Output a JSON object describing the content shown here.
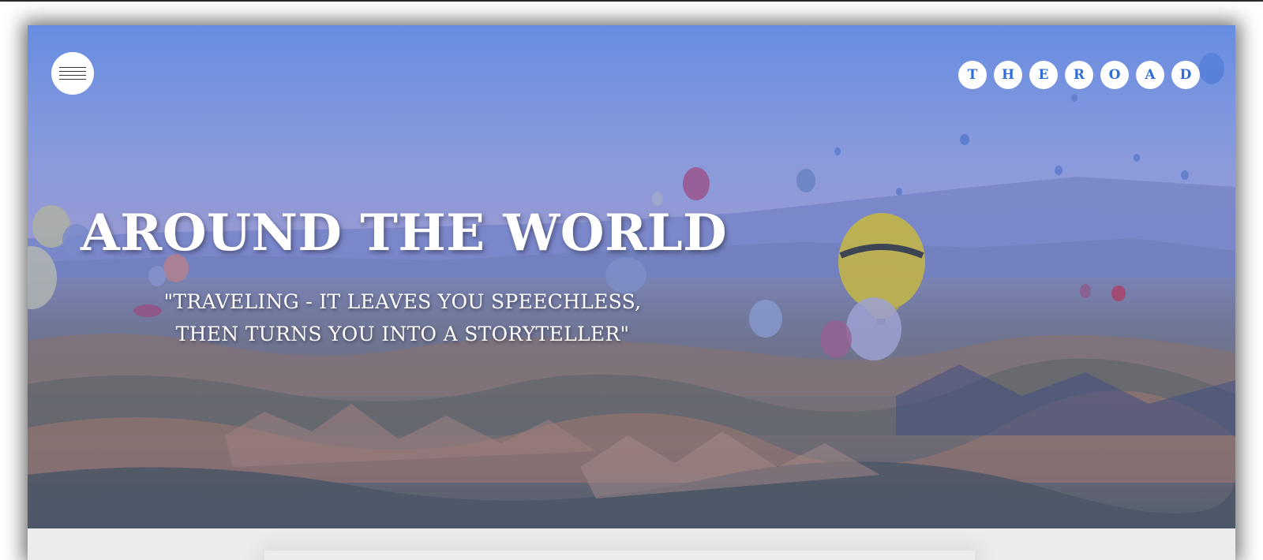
{
  "header": {
    "menu_icon": "hamburger-icon",
    "logo_letters": [
      "T",
      "H",
      "E",
      "R",
      "O",
      "A",
      "D"
    ]
  },
  "hero": {
    "title": "AROUND THE WORLD",
    "quote_line_1": "\"TRAVELING - IT LEAVES YOU SPEECHLESS,",
    "quote_line_2": "THEN TURNS YOU INTO A STORYTELLER\""
  },
  "colors": {
    "logo_text": "#2f6ed6",
    "logo_bg": "#ffffff",
    "hero_text": "#ffffff"
  }
}
